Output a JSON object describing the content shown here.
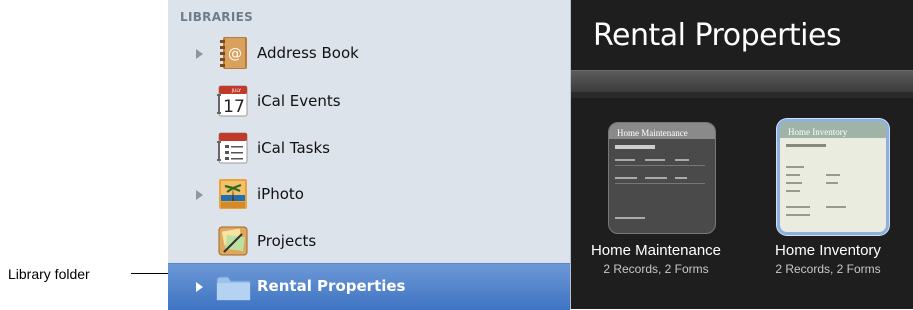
{
  "callout": {
    "label": "Library folder"
  },
  "sidebar": {
    "heading": "LIBRARIES",
    "items": [
      {
        "label": "Address Book",
        "icon": "address-book-icon",
        "has_disclosure": true
      },
      {
        "label": "iCal Events",
        "icon": "calendar-icon",
        "icon_text": "17",
        "icon_month": "JULY",
        "has_disclosure": false
      },
      {
        "label": "iCal Tasks",
        "icon": "task-list-icon",
        "has_disclosure": false
      },
      {
        "label": "iPhoto",
        "icon": "iphoto-icon",
        "has_disclosure": true
      },
      {
        "label": "Projects",
        "icon": "projects-icon",
        "has_disclosure": false
      },
      {
        "label": "Rental Properties",
        "icon": "folder-icon",
        "has_disclosure": true,
        "selected": true
      }
    ]
  },
  "panel": {
    "title": "Rental Properties",
    "databases": [
      {
        "name": "Home Maintenance",
        "subtitle": "2 Records, 2 Forms",
        "thumb_title": "Home Maintenance"
      },
      {
        "name": "Home Inventory",
        "subtitle": "2 Records, 2 Forms",
        "thumb_title": "Home Inventory",
        "selected": true
      }
    ]
  },
  "colors": {
    "sidebar_bg": "#dde3ea",
    "selection": "#4a7fcc",
    "panel_bg": "#1e1e1e",
    "heading": "#6e7d8c"
  }
}
